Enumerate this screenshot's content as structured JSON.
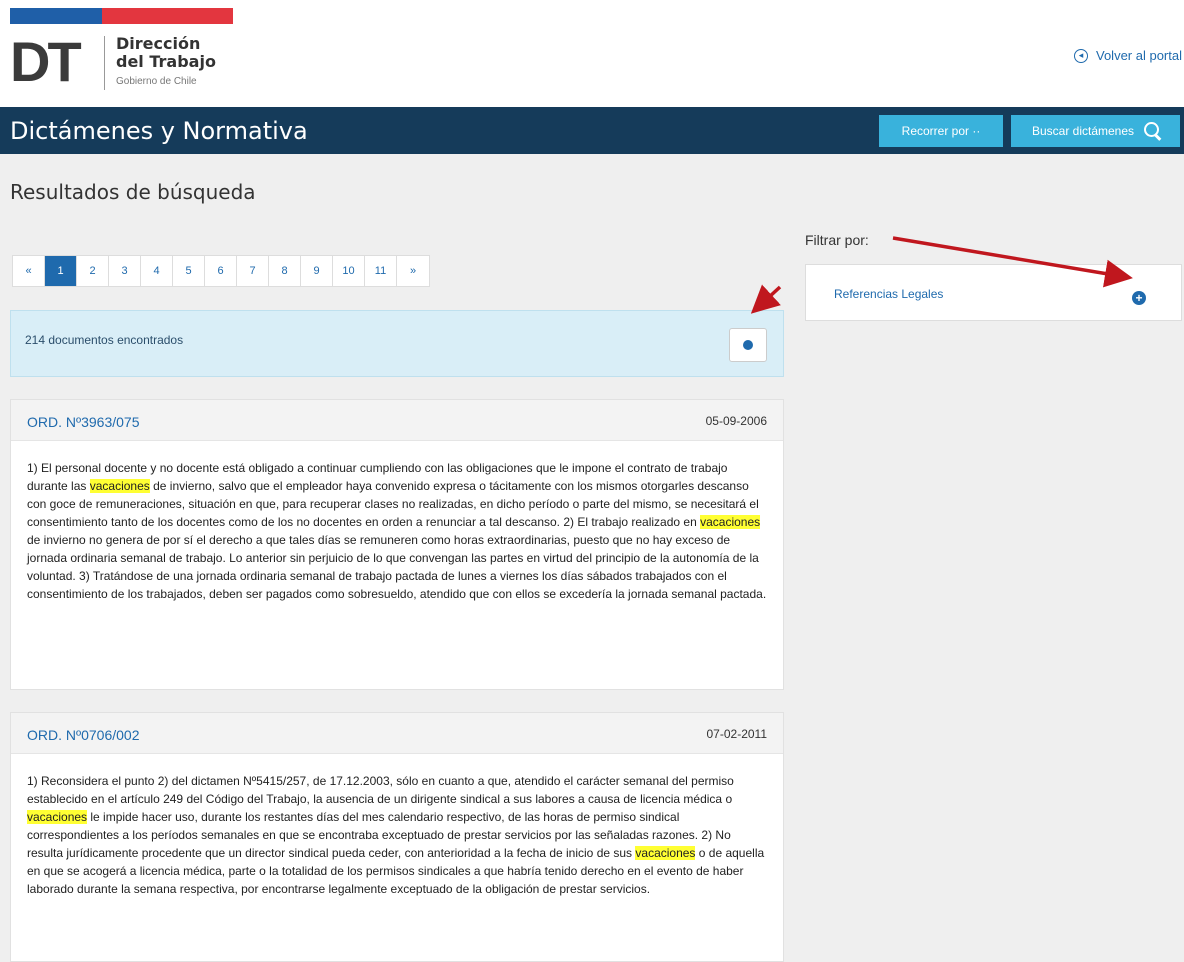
{
  "header": {
    "logo_letters": "DT",
    "org_line1": "Dirección",
    "org_line2": "del Trabajo",
    "org_line3": "Gobierno de Chile",
    "back_link": "Volver al portal",
    "flag_colors": [
      "#1f5fa8",
      "#e3363f"
    ]
  },
  "navbar": {
    "title": "Dictámenes y Normativa",
    "recorrer_label": "Recorrer por ··",
    "buscar_label": "Buscar dictámenes",
    "bar_color": "#153b5a",
    "button_color": "#39b2dc"
  },
  "page": {
    "heading": "Resultados de búsqueda"
  },
  "pagination": {
    "prev": "«",
    "pages": [
      "1",
      "2",
      "3",
      "4",
      "5",
      "6",
      "7",
      "8",
      "9",
      "10",
      "11"
    ],
    "next": "»",
    "active_page": "1"
  },
  "results": {
    "count_text": "214 documentos encontrados"
  },
  "documents": [
    {
      "title": "ORD. Nº3963/075",
      "date": "05-09-2006",
      "parts": [
        "1) El personal docente y no docente está obligado a continuar cumpliendo con las obligaciones que le impone el contrato de trabajo durante las ",
        "vacaciones",
        " de invierno, salvo que el empleador haya convenido expresa o tácitamente con los mismos otorgarles descanso con goce de remuneraciones, situación en que, para recuperar clases no realizadas, en dicho período o parte del mismo, se necesitará el consentimiento tanto de los docentes como de los no docentes en orden a renunciar a tal descanso. 2) El trabajo realizado en ",
        "vacaciones",
        " de invierno no genera de por sí el derecho a que tales días se remuneren como horas extraordinarias, puesto que no hay exceso de jornada ordinaria semanal de trabajo. Lo anterior sin perjuicio de lo que convengan las partes en virtud del principio de la autonomía de la voluntad. 3) Tratándose de una jornada ordinaria semanal de trabajo pactada de lunes a viernes los días sábados trabajados con el consentimiento de los trabajados, deben ser pagados como sobresueldo, atendido que con ellos se excedería la jornada semanal pactada."
      ]
    },
    {
      "title": "ORD. Nº0706/002",
      "date": "07-02-2011",
      "parts": [
        "1) Reconsidera el punto 2) del dictamen Nº5415/257, de 17.12.2003, sólo en cuanto a que, atendido el carácter semanal del permiso establecido en el artículo 249 del Código del Trabajo, la ausencia de un dirigente sindical a sus labores a causa de licencia médica o ",
        "vacaciones",
        " le impide hacer uso, durante los restantes días del mes calendario respectivo, de las horas de permiso sindical correspondientes a los períodos semanales en que se encontraba exceptuado de prestar servicios por las señaladas razones. 2) No resulta jurídicamente procedente que un director sindical pueda ceder, con anterioridad a la fecha de inicio de sus ",
        "vacaciones",
        " o de aquella en que se acogerá a licencia médica, parte o la totalidad de los permisos sindicales a que habría tenido derecho en el evento de haber laborado durante la semana respectiva, por encontrarse legalmente exceptuado de la obligación de prestar servicios."
      ]
    }
  ],
  "filter": {
    "label": "Filtrar por:",
    "item": "Referencias Legales",
    "plus": "+"
  },
  "highlight_color": "#ffff33",
  "annotation_color": "#c0171e"
}
